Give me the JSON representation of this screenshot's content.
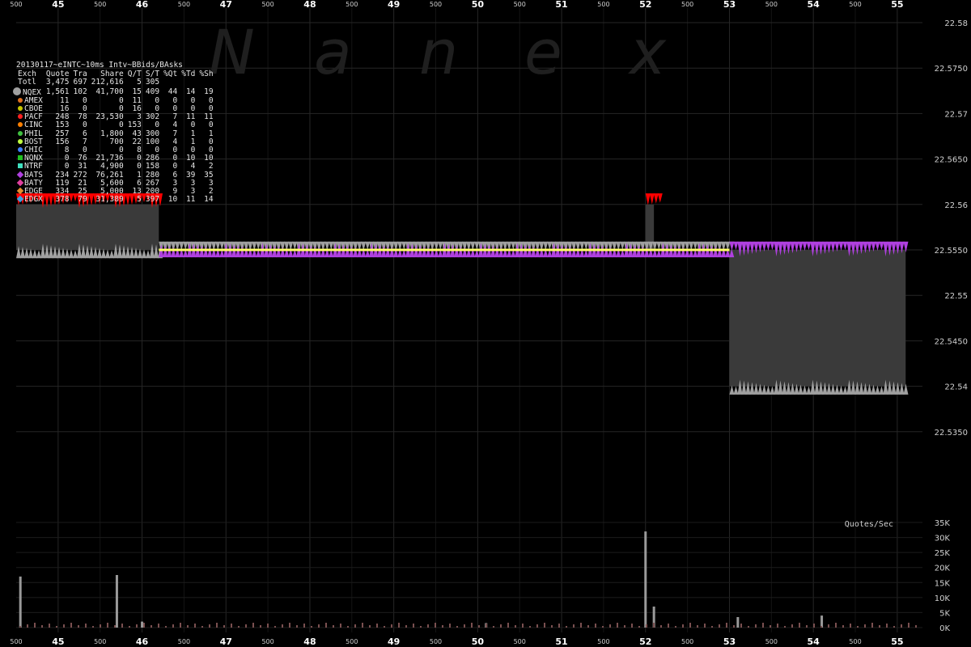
{
  "watermark": [
    "N",
    "a",
    "n",
    "e",
    "x"
  ],
  "panel": {
    "title": "20130117~eINTC~10ms Intv~BBids/BAsks",
    "columns": [
      "Exch",
      "Quote",
      "Tra",
      "Share",
      "Q/T",
      "S/T",
      "%Qt",
      "%Td",
      "%Sh"
    ],
    "total": {
      "name": "Totl",
      "quote": "3,475",
      "tra": "697",
      "share": "212,616",
      "qt": "5",
      "st": "305",
      "pqt": "",
      "ptd": "",
      "psh": ""
    },
    "rows": [
      {
        "name": "NQEX",
        "quote": "1,561",
        "tra": "102",
        "share": "41,700",
        "qt": "15",
        "st": "409",
        "pqt": "44",
        "ptd": "14",
        "psh": "19",
        "color": "#a0a0a0",
        "marker": "big"
      },
      {
        "name": "AMEX",
        "quote": "11",
        "tra": "0",
        "share": "0",
        "qt": "11",
        "st": "0",
        "pqt": "0",
        "ptd": "0",
        "psh": "0",
        "color": "#e07020",
        "marker": "dot"
      },
      {
        "name": "CBOE",
        "quote": "16",
        "tra": "0",
        "share": "0",
        "qt": "16",
        "st": "0",
        "pqt": "0",
        "ptd": "0",
        "psh": "0",
        "color": "#c8c800",
        "marker": "dot"
      },
      {
        "name": "PACF",
        "quote": "248",
        "tra": "78",
        "share": "23,530",
        "qt": "3",
        "st": "302",
        "pqt": "7",
        "ptd": "11",
        "psh": "11",
        "color": "#ff2020",
        "marker": "dot"
      },
      {
        "name": "CINC",
        "quote": "153",
        "tra": "0",
        "share": "0",
        "qt": "153",
        "st": "0",
        "pqt": "4",
        "ptd": "0",
        "psh": "0",
        "color": "#ff8000",
        "marker": "dot"
      },
      {
        "name": "PHIL",
        "quote": "257",
        "tra": "6",
        "share": "1,800",
        "qt": "43",
        "st": "300",
        "pqt": "7",
        "ptd": "1",
        "psh": "1",
        "color": "#40c040",
        "marker": "dot"
      },
      {
        "name": "BOST",
        "quote": "156",
        "tra": "7",
        "share": "700",
        "qt": "22",
        "st": "100",
        "pqt": "4",
        "ptd": "1",
        "psh": "0",
        "color": "#c0ff40",
        "marker": "dot"
      },
      {
        "name": "CHIC",
        "quote": "8",
        "tra": "0",
        "share": "0",
        "qt": "8",
        "st": "0",
        "pqt": "0",
        "ptd": "0",
        "psh": "0",
        "color": "#4080ff",
        "marker": "dot"
      },
      {
        "name": "NQNX",
        "quote": "0",
        "tra": "76",
        "share": "21,736",
        "qt": "0",
        "st": "286",
        "pqt": "0",
        "ptd": "10",
        "psh": "10",
        "color": "#20c020",
        "marker": "sq"
      },
      {
        "name": "NTRF",
        "quote": "0",
        "tra": "31",
        "share": "4,900",
        "qt": "0",
        "st": "158",
        "pqt": "0",
        "ptd": "4",
        "psh": "2",
        "color": "#40e0c0",
        "marker": "sq"
      },
      {
        "name": "BATS",
        "quote": "234",
        "tra": "272",
        "share": "76,261",
        "qt": "1",
        "st": "280",
        "pqt": "6",
        "ptd": "39",
        "psh": "35",
        "color": "#b040e0",
        "marker": "dia"
      },
      {
        "name": "BATY",
        "quote": "119",
        "tra": "21",
        "share": "5,600",
        "qt": "6",
        "st": "267",
        "pqt": "3",
        "ptd": "3",
        "psh": "3",
        "color": "#e040a0",
        "marker": "dia"
      },
      {
        "name": "EDGE",
        "quote": "334",
        "tra": "25",
        "share": "5,000",
        "qt": "13",
        "st": "200",
        "pqt": "9",
        "ptd": "3",
        "psh": "2",
        "color": "#e09030",
        "marker": "dia"
      },
      {
        "name": "EDGX",
        "quote": "378",
        "tra": "79",
        "share": "31,389",
        "qt": "5",
        "st": "397",
        "pqt": "10",
        "ptd": "11",
        "psh": "14",
        "color": "#40a0e0",
        "marker": "dia"
      }
    ]
  },
  "chart_data": {
    "type": "line",
    "x_ticks": [
      "45",
      "46",
      "47",
      "48",
      "49",
      "50",
      "51",
      "52",
      "53",
      "54",
      "55"
    ],
    "x_half_label": "500",
    "xlim": [
      44.5,
      55.3
    ],
    "price_axis": {
      "ticks": [
        "22.58",
        "22.5750",
        "22.57",
        "22.5650",
        "22.56",
        "22.5550",
        "22.55",
        "22.5450",
        "22.54",
        "22.5350"
      ],
      "ylim": [
        22.53,
        22.58
      ]
    },
    "nbbo_spread": [
      {
        "x0": 44.5,
        "x1": 46.2,
        "bid": 22.555,
        "ask": 22.56
      },
      {
        "x0": 52.0,
        "x1": 52.1,
        "bid": 22.555,
        "ask": 22.56
      },
      {
        "x0": 53.0,
        "x1": 55.1,
        "bid": 22.54,
        "ask": 22.555
      }
    ],
    "quotes_panel": {
      "label": "Quotes/Sec",
      "ticks": [
        "35K",
        "30K",
        "25K",
        "20K",
        "15K",
        "10K",
        "5K",
        "0K"
      ],
      "ylim": [
        0,
        35000
      ],
      "spikes": [
        {
          "x": 44.55,
          "value": 17000
        },
        {
          "x": 45.7,
          "value": 17500
        },
        {
          "x": 46.0,
          "value": 2000
        },
        {
          "x": 50.1,
          "value": 1500
        },
        {
          "x": 52.0,
          "value": 32000
        },
        {
          "x": 52.1,
          "value": 7000
        },
        {
          "x": 53.1,
          "value": 3500
        },
        {
          "x": 54.1,
          "value": 4000
        }
      ]
    },
    "colors": {
      "bid": "#a0a0a0",
      "pacf": "#ff0000",
      "bats": "#b040e0",
      "trade": "#ffff66",
      "spread": "#3a3a3a",
      "grid": "#262626"
    }
  }
}
